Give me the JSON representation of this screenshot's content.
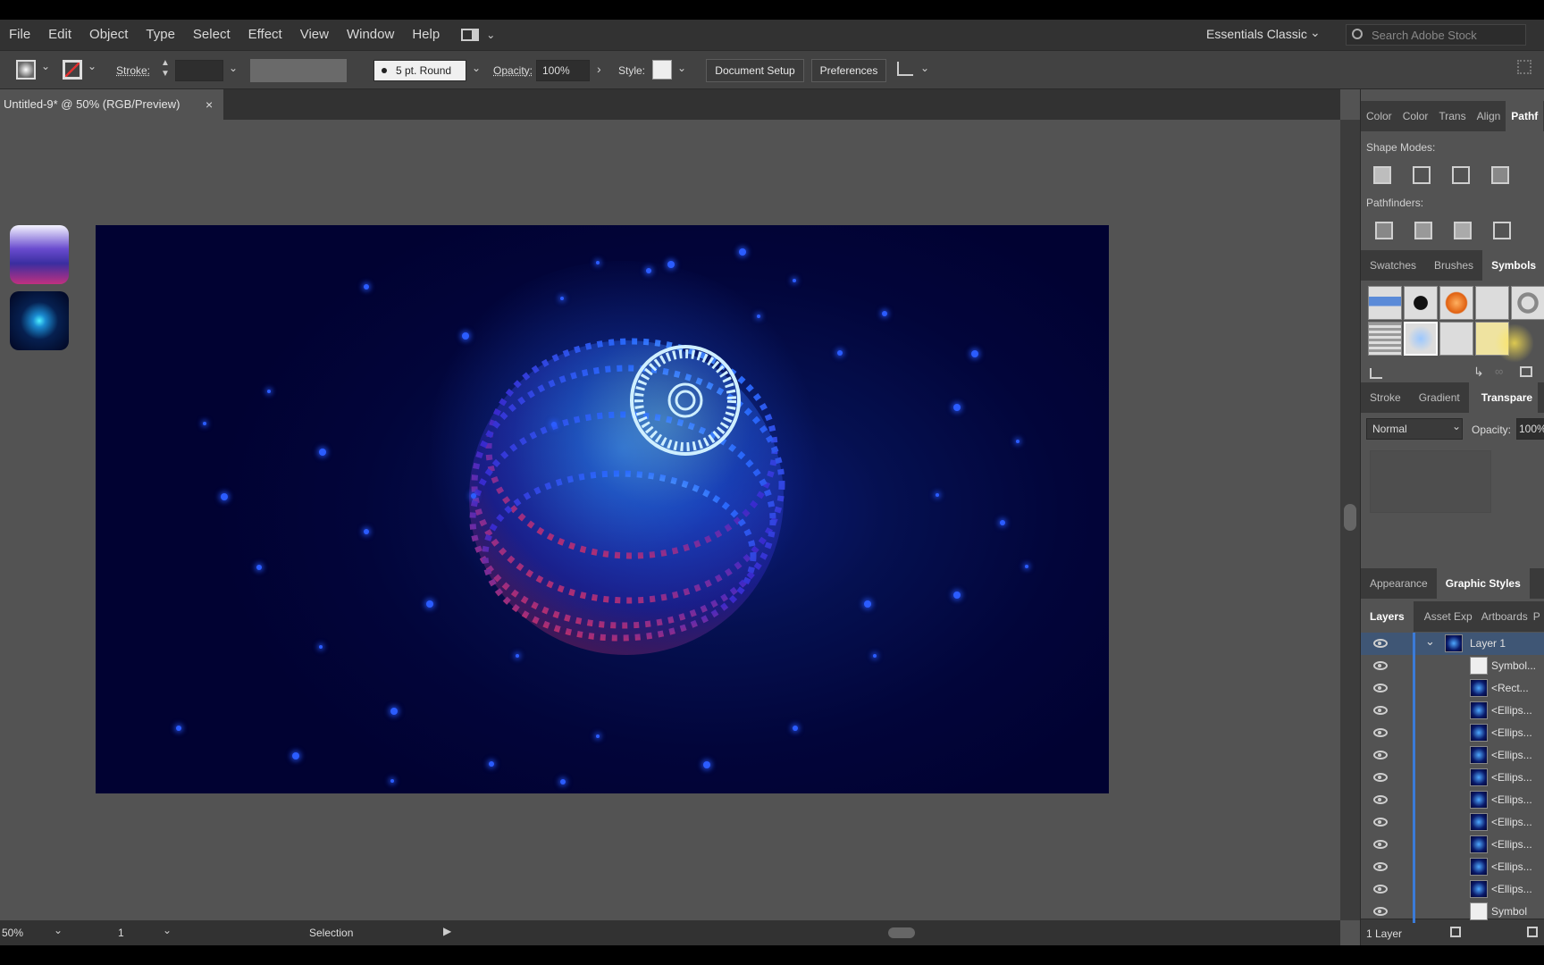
{
  "menu": [
    "File",
    "Edit",
    "Object",
    "Type",
    "Select",
    "Effect",
    "View",
    "Window",
    "Help"
  ],
  "workspace": "Essentials Classic",
  "search_placeholder": "Search Adobe Stock",
  "control": {
    "stroke_label": "Stroke:",
    "brush": "5 pt. Round",
    "opacity_label": "Opacity:",
    "opacity_value": "100%",
    "style_label": "Style:",
    "doc_setup": "Document Setup",
    "preferences": "Preferences"
  },
  "doc_tab": "Untitled-9* @ 50% (RGB/Preview)",
  "status": {
    "zoom": "50%",
    "artboard": "1",
    "tool": "Selection"
  },
  "panels": {
    "top_tabs": [
      "Color",
      "Color",
      "Trans",
      "Align",
      "Pathf"
    ],
    "shape_modes": "Shape Modes:",
    "pathfinders": "Pathfinders:",
    "lib_tabs": [
      "Swatches",
      "Brushes",
      "Symbols"
    ],
    "stroke_tabs": [
      "Stroke",
      "Gradient",
      "Transpare"
    ],
    "blend_mode": "Normal",
    "opacity_label": "Opacity:",
    "opacity_value": "100%",
    "appearance_tabs": [
      "Appearance",
      "Graphic Styles"
    ],
    "layer_tabs": [
      "Layers",
      "Asset Exp",
      "Artboards",
      "P"
    ],
    "layers": [
      "Layer 1",
      "Symbol...",
      "<Rect...",
      "<Ellips...",
      "<Ellips...",
      "<Ellips...",
      "<Ellips...",
      "<Ellips...",
      "<Ellips...",
      "<Ellips...",
      "<Ellips...",
      "<Ellips...",
      "Symbol"
    ],
    "layer_count": "1 Layer"
  }
}
